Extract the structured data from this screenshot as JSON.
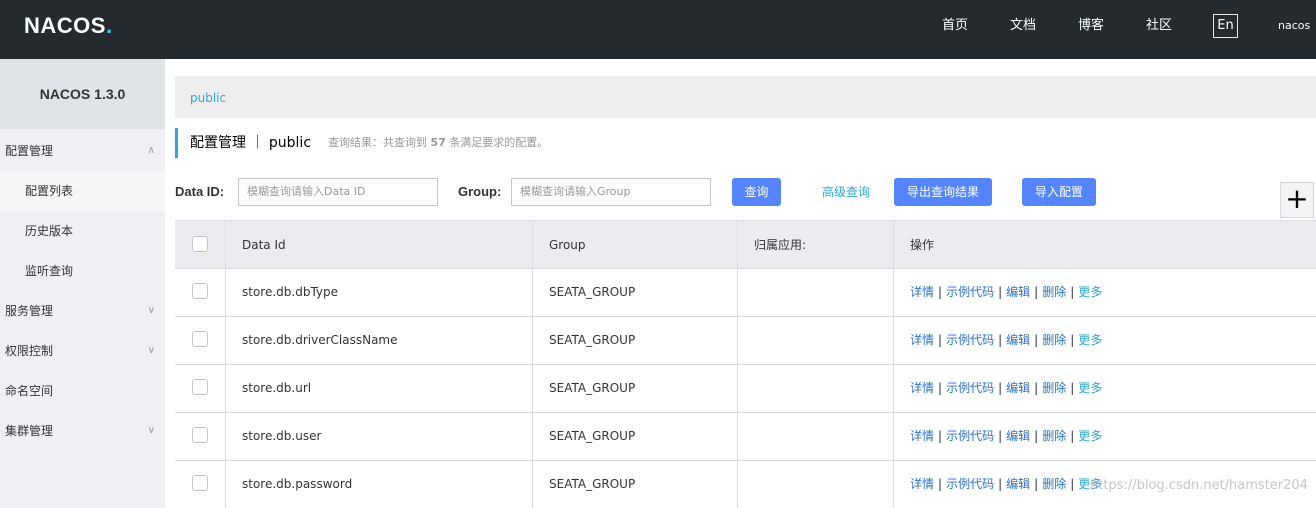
{
  "header": {
    "logo": "NACOS",
    "logo_dot": ".",
    "nav": [
      "首页",
      "文档",
      "博客",
      "社区"
    ],
    "lang": "En",
    "user": "nacos"
  },
  "sidebar": {
    "version": "NACOS 1.3.0",
    "items": [
      {
        "label": "配置管理",
        "caret": "∧"
      },
      {
        "label": "配置列表"
      },
      {
        "label": "历史版本"
      },
      {
        "label": "监听查询"
      },
      {
        "label": "服务管理",
        "caret": "∨"
      },
      {
        "label": "权限控制",
        "caret": "∨"
      },
      {
        "label": "命名空间"
      },
      {
        "label": "集群管理",
        "caret": "∨"
      }
    ]
  },
  "breadcrumb": "public",
  "title": "配置管理 ｜ public",
  "query_info": {
    "prefix": "查询结果：共查询到",
    "count": "57",
    "suffix": "条满足要求的配置。"
  },
  "filters": {
    "data_id_label": "Data ID:",
    "data_id_placeholder": "模糊查询请输入Data ID",
    "group_label": "Group:",
    "group_placeholder": "模糊查询请输入Group",
    "query_button": "查询",
    "advanced_query": "高级查询",
    "export_button": "导出查询结果",
    "import_button": "导入配置",
    "add_button": "+"
  },
  "table": {
    "columns": [
      "Data Id",
      "Group",
      "归属应用:",
      "操作"
    ],
    "rows": [
      {
        "data_id": "store.db.dbType",
        "group": "SEATA_GROUP",
        "app": ""
      },
      {
        "data_id": "store.db.driverClassName",
        "group": "SEATA_GROUP",
        "app": ""
      },
      {
        "data_id": "store.db.url",
        "group": "SEATA_GROUP",
        "app": ""
      },
      {
        "data_id": "store.db.user",
        "group": "SEATA_GROUP",
        "app": ""
      },
      {
        "data_id": "store.db.password",
        "group": "SEATA_GROUP",
        "app": ""
      }
    ],
    "ops": {
      "detail": "详情",
      "sample": "示例代码",
      "edit": "编辑",
      "delete": "删除",
      "more": "更多",
      "sep": "|"
    }
  },
  "watermark": "https://blog.csdn.net/hamster204",
  "colors": {
    "accent": "#2fa8d6",
    "primary_button": "#5584ff",
    "topbar": "#252a2f"
  }
}
